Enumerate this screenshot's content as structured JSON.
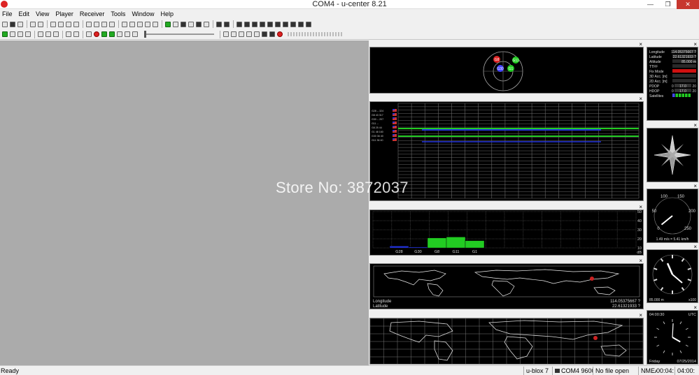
{
  "window": {
    "title": "COM4 - u-center 8.21",
    "minimize": "—",
    "maximize": "❐",
    "close": "✕"
  },
  "menu": [
    "File",
    "Edit",
    "View",
    "Player",
    "Receiver",
    "Tools",
    "Window",
    "Help"
  ],
  "sky_view": {
    "satellites": [
      "G8",
      "G11",
      "G30",
      "G1"
    ]
  },
  "signal_history": {
    "rows": [
      "G28 -- 324",
      "G8 43 317",
      "G30 -- 207",
      "G11 --",
      "G8 25 44",
      "G1 48 160",
      "G30 36 40",
      "G11 36 40"
    ]
  },
  "signal_chart": {
    "chart_data": {
      "type": "bar",
      "categories": [
        "G28",
        "G30",
        "G8",
        "G11",
        "G1"
      ],
      "values": [
        12,
        11,
        21,
        22,
        18
      ],
      "ylim": [
        10,
        50
      ],
      "yticks": [
        10,
        20,
        30,
        40,
        50
      ],
      "xlabel": "dB"
    }
  },
  "world_map": {
    "longitude_label": "Longitude",
    "longitude_value": "114.05375667 ?",
    "latitude_label": "Latitude",
    "latitude_value": "22.61321933 ?"
  },
  "data_view": {
    "rows": [
      {
        "label": "Longitude",
        "value": "114.05375667 ?"
      },
      {
        "label": "Latitude",
        "value": "22.61321933 ?"
      },
      {
        "label": "Altitude",
        "value": "85.000 m"
      },
      {
        "label": "TTFF",
        "value": ""
      },
      {
        "label": "Fix Mode",
        "value": ""
      },
      {
        "label": "3D Acc. [m]",
        "value": ""
      },
      {
        "label": "2D Acc. [m]",
        "value": ""
      },
      {
        "label": "PDOP",
        "value": "17.0"
      },
      {
        "label": "HDOP",
        "value": "17.0"
      },
      {
        "label": "Satellites",
        "value": ""
      }
    ],
    "pdop_min": "0",
    "pdop_max": "20",
    "hdop_min": "0",
    "hdop_max": "20",
    "fix_color": "#d01010"
  },
  "speedometer": {
    "ticks": [
      "0",
      "50",
      "100",
      "150",
      "200",
      "250"
    ],
    "speed_text": "1.49 m/s = 5.41 km/h",
    "speed_kmh": 5.41
  },
  "altimeter": {
    "altitude_text": "85.000 m",
    "scale": "x100"
  },
  "clock": {
    "time": "04:00:30",
    "zone": "UTC",
    "day": "Friday",
    "date": "07/25/2014",
    "hour": 4,
    "minute": 0,
    "second": 30
  },
  "status": {
    "ready": "Ready",
    "receiver": "u-blox 7",
    "port": "COM4 9600",
    "file": "No file open",
    "protocol": "NMEA",
    "time1": "00:04:",
    "time2": "04:00:"
  },
  "watermark": "Store No: 3872037",
  "colors": {
    "pane_bg": "#000000",
    "grid": "#6a6a6a",
    "signal_green": "#22cc22",
    "signal_blue": "#2233dd",
    "workspace": "#ababab"
  }
}
